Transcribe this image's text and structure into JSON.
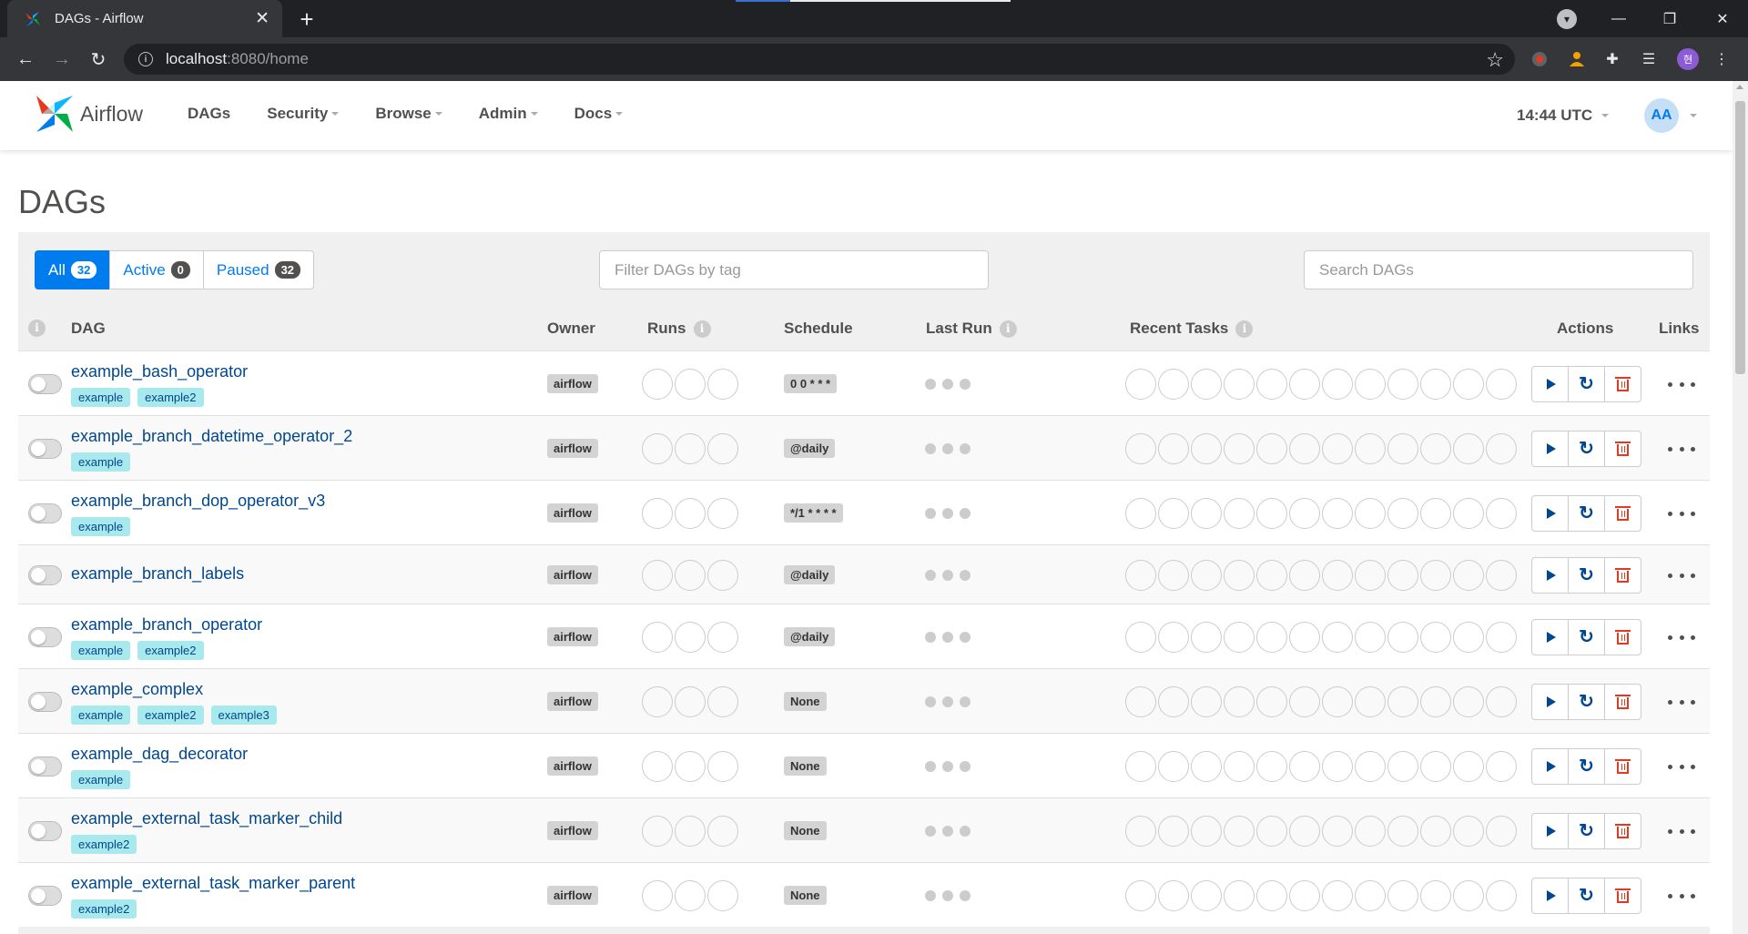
{
  "browser": {
    "tab_title": "DAGs - Airflow",
    "url_host": "localhost",
    "url_rest": ":8080/home",
    "profile_initial": "현"
  },
  "app": {
    "brand": "Airflow",
    "nav": [
      {
        "label": "DAGs"
      },
      {
        "label": "Security"
      },
      {
        "label": "Browse"
      },
      {
        "label": "Admin"
      },
      {
        "label": "Docs"
      }
    ],
    "clock": "14:44 UTC",
    "user_initials": "AA"
  },
  "page": {
    "title": "DAGs",
    "status_filters": [
      {
        "label": "All",
        "count": "32"
      },
      {
        "label": "Active",
        "count": "0"
      },
      {
        "label": "Paused",
        "count": "32"
      }
    ],
    "tag_filter_placeholder": "Filter DAGs by tag",
    "search_placeholder": "Search DAGs"
  },
  "table": {
    "headers": {
      "info": "i",
      "dag": "DAG",
      "owner": "Owner",
      "runs": "Runs",
      "schedule": "Schedule",
      "last_run": "Last Run",
      "recent_tasks": "Recent Tasks",
      "actions": "Actions",
      "links": "Links"
    },
    "rows": [
      {
        "dag_id": "example_bash_operator",
        "tags": [
          "example",
          "example2"
        ],
        "owner": "airflow",
        "schedule": "0 0 * * *"
      },
      {
        "dag_id": "example_branch_datetime_operator_2",
        "tags": [
          "example"
        ],
        "owner": "airflow",
        "schedule": "@daily"
      },
      {
        "dag_id": "example_branch_dop_operator_v3",
        "tags": [
          "example"
        ],
        "owner": "airflow",
        "schedule": "*/1 * * * *"
      },
      {
        "dag_id": "example_branch_labels",
        "tags": [],
        "owner": "airflow",
        "schedule": "@daily"
      },
      {
        "dag_id": "example_branch_operator",
        "tags": [
          "example",
          "example2"
        ],
        "owner": "airflow",
        "schedule": "@daily"
      },
      {
        "dag_id": "example_complex",
        "tags": [
          "example",
          "example2",
          "example3"
        ],
        "owner": "airflow",
        "schedule": "None"
      },
      {
        "dag_id": "example_dag_decorator",
        "tags": [
          "example"
        ],
        "owner": "airflow",
        "schedule": "None"
      },
      {
        "dag_id": "example_external_task_marker_child",
        "tags": [
          "example2"
        ],
        "owner": "airflow",
        "schedule": "None"
      },
      {
        "dag_id": "example_external_task_marker_parent",
        "tags": [
          "example2"
        ],
        "owner": "airflow",
        "schedule": "None"
      }
    ]
  },
  "colors": {
    "accent": "#017cee",
    "dag_link": "#00478d",
    "tag_bg": "#a7e9ec",
    "delete": "#e43921"
  }
}
